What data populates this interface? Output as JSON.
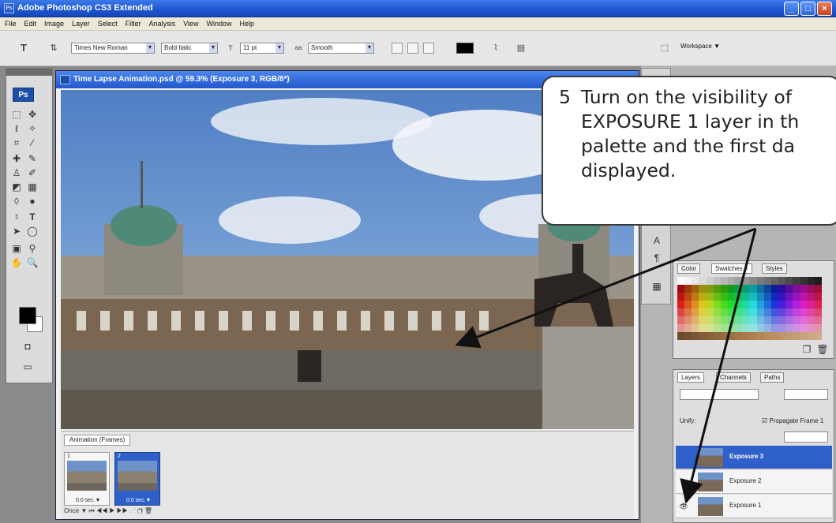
{
  "app": {
    "title": "Adobe Photoshop CS3 Extended",
    "icon": "ps-app-icon",
    "window_buttons": [
      "_",
      "□",
      "×"
    ]
  },
  "menubar": {
    "items": [
      "File",
      "Edit",
      "Image",
      "Layer",
      "Select",
      "Filter",
      "Analysis",
      "View",
      "Window",
      "Help"
    ]
  },
  "options": {
    "font_family": "Times New Roman",
    "font_style": "Bold Italic",
    "font_size": "11 pt",
    "antialias": "Smooth",
    "text_color": "#000000",
    "workspace_label": "Workspace ▼"
  },
  "tools": {
    "logo": "Ps",
    "foreground": "#000000",
    "background": "#ffffff"
  },
  "document": {
    "title": "Time Lapse Animation.psd @ 59.3% (Exposure 3, RGB/8*)"
  },
  "animation": {
    "tab_label": "Animation (Frames)",
    "frames": [
      {
        "number": "1",
        "delay": "0.0 sec.▼"
      },
      {
        "number": "2",
        "delay": "0.0 sec.▼"
      }
    ],
    "loop": "Once",
    "selected_frame": 2
  },
  "palettes": {
    "tabs": [
      "Color",
      "Swatches ×",
      "Styles"
    ]
  },
  "layers": {
    "tabs": [
      "Layers",
      "Channels",
      "Paths"
    ],
    "unify_label": "Unify:",
    "propagate_label": "Propagate Frame 1",
    "rows": [
      {
        "name": "Exposure 3",
        "visible": false,
        "selected": true
      },
      {
        "name": "Exposure 2",
        "visible": false,
        "selected": false
      },
      {
        "name": "Exposure 1",
        "visible": true,
        "selected": false
      }
    ]
  },
  "callout": {
    "number": "5",
    "lines": [
      "Turn on the visibility of",
      "EXPOSURE 1 layer in th",
      "palette and the first da",
      "displayed."
    ]
  }
}
